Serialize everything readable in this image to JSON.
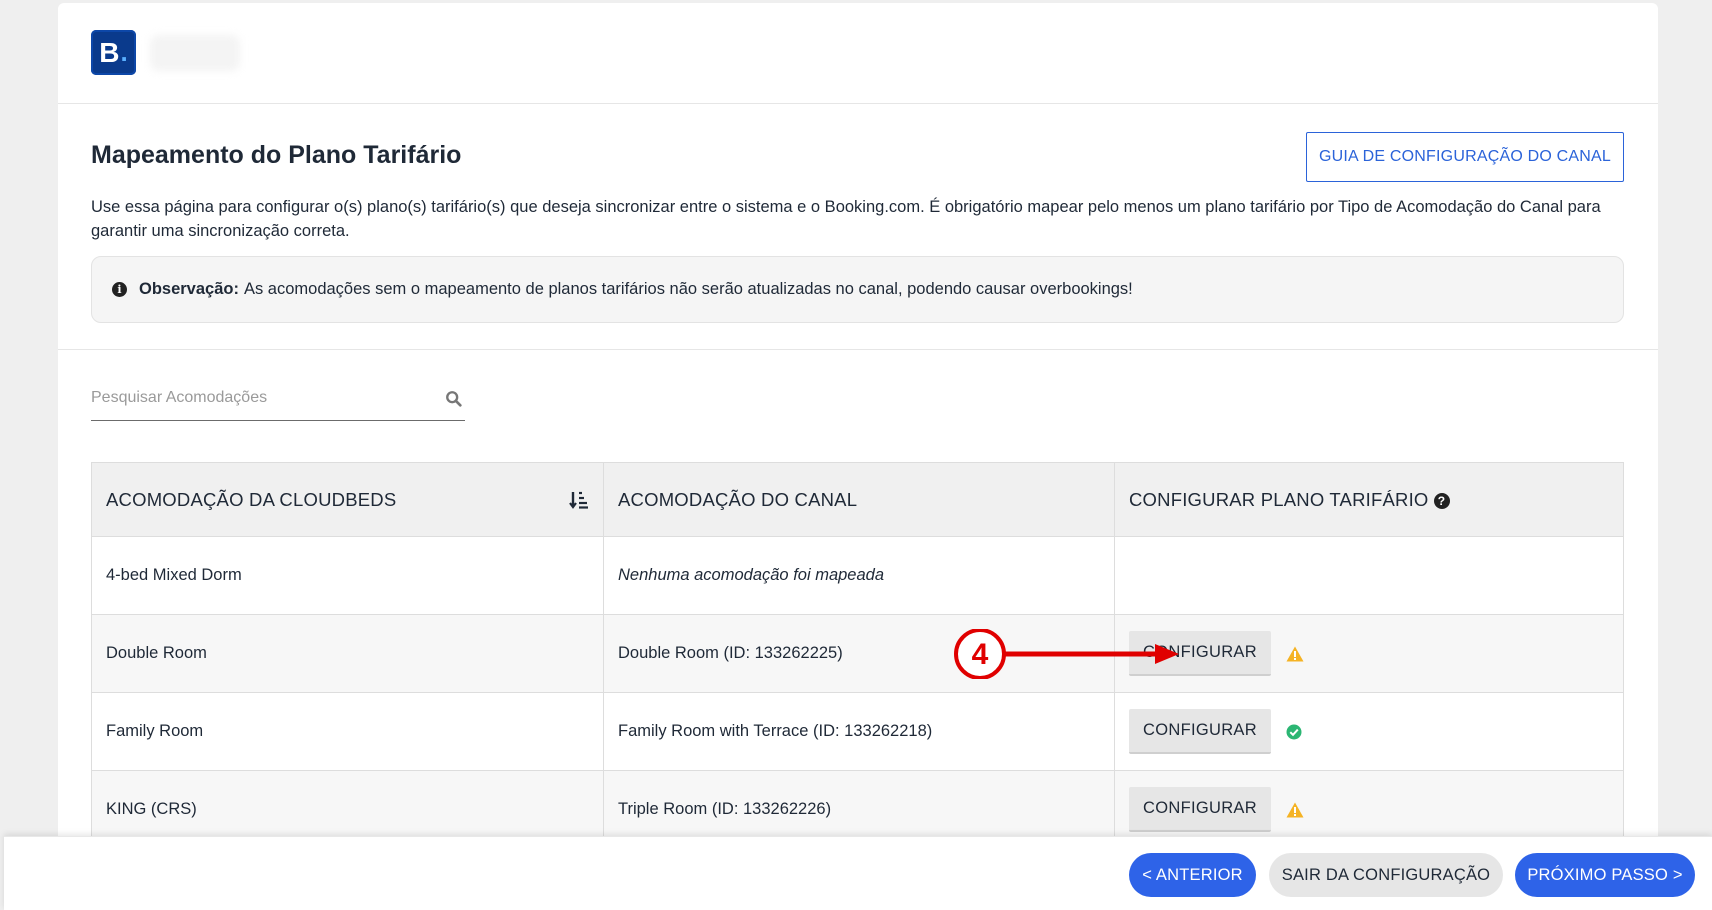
{
  "brand": {
    "logo_letter": "B",
    "logo_dot": "."
  },
  "page": {
    "title": "Mapeamento do Plano Tarifário",
    "guide_button": "GUIA DE CONFIGURAÇÃO DO CANAL",
    "intro": "Use essa página para configurar o(s) plano(s) tarifário(s) que deseja sincronizar entre o sistema e o Booking.com. É obrigatório mapear pelo menos um plano tarifário por Tipo de Acomodação do Canal para garantir uma sincronização correta.",
    "note_label": "Observação:",
    "note_text": "As acomodações sem o mapeamento de planos tarifários não serão atualizadas no canal, podendo causar overbookings!"
  },
  "search": {
    "placeholder": "Pesquisar Acomodações"
  },
  "table": {
    "headers": [
      "ACOMODAÇÃO DA CLOUDBEDS",
      "ACOMODAÇÃO DO CANAL",
      "CONFIGURAR PLANO TARIFÁRIO"
    ],
    "rows": [
      {
        "cloudbeds": "4-bed Mixed Dorm",
        "channel": "Nenhuma acomodação foi mapeada",
        "button": "",
        "status": ""
      },
      {
        "cloudbeds": "Double Room",
        "channel": "Double Room (ID: 133262225)",
        "button": "CONFIGURAR",
        "status": "warning"
      },
      {
        "cloudbeds": "Family Room",
        "channel": "Family Room with Terrace (ID: 133262218)",
        "button": "CONFIGURAR",
        "status": "ok"
      },
      {
        "cloudbeds": "KING (CRS)",
        "channel": "Triple Room (ID: 133262226)",
        "button": "CONFIGURAR",
        "status": "warning"
      }
    ]
  },
  "annotation": {
    "step": "4"
  },
  "footer": {
    "prev": "< ANTERIOR",
    "exit": "SAIR DA CONFIGURAÇÃO",
    "next": "PRÓXIMO PASSO >"
  },
  "colors": {
    "primary": "#2e63e8",
    "warning": "#f5b324",
    "success": "#2bb673",
    "annotation": "#e00000",
    "logo": "#0a3a8c"
  }
}
